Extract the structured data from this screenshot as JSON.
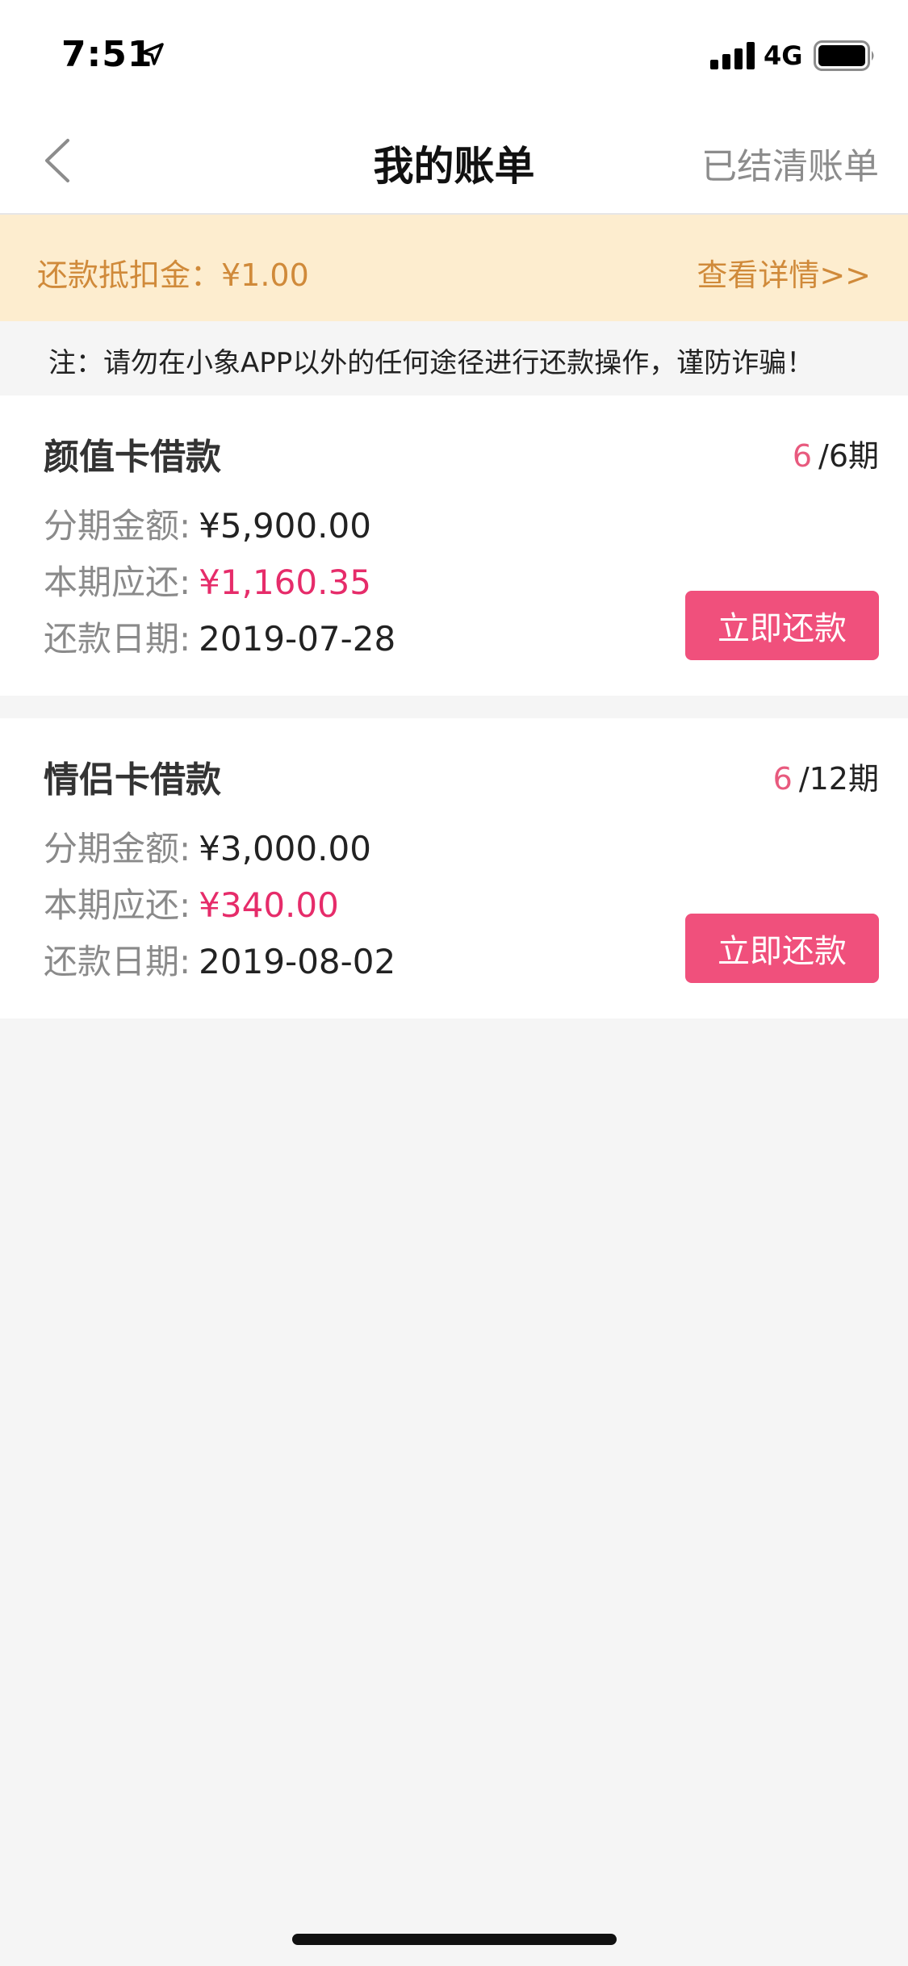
{
  "status": {
    "time": "7:51",
    "network": "4G"
  },
  "nav": {
    "title": "我的账单",
    "right_link": "已结清账单"
  },
  "deduct": {
    "label": "还款抵扣金：¥1.00",
    "link": "查看详情>>"
  },
  "notice": {
    "text": "注：请勿在小象APP以外的任何途径进行还款操作，谨防诈骗！"
  },
  "bills": [
    {
      "title": "颜值卡借款",
      "period_current": "6",
      "period_total": "/6期",
      "amount_label": "分期金额:",
      "amount_value": "¥5,900.00",
      "due_label": "本期应还:",
      "due_value": "¥1,160.35",
      "date_label": "还款日期:",
      "date_value": "2019-07-28",
      "button": "立即还款"
    },
    {
      "title": "情侣卡借款",
      "period_current": "6",
      "period_total": "/12期",
      "amount_label": "分期金额:",
      "amount_value": "¥3,000.00",
      "due_label": "本期应还:",
      "due_value": "¥340.00",
      "date_label": "还款日期:",
      "date_value": "2019-08-02",
      "button": "立即还款"
    }
  ],
  "colors": {
    "accent_pink": "#f0507c",
    "due_red": "#e62c6a",
    "banner_bg": "#fdedcf",
    "banner_text": "#d08a3a"
  },
  "icons": {
    "location": "location-arrow-icon",
    "signal": "signal-bars-icon",
    "battery": "battery-icon",
    "back": "back-chevron-icon"
  }
}
